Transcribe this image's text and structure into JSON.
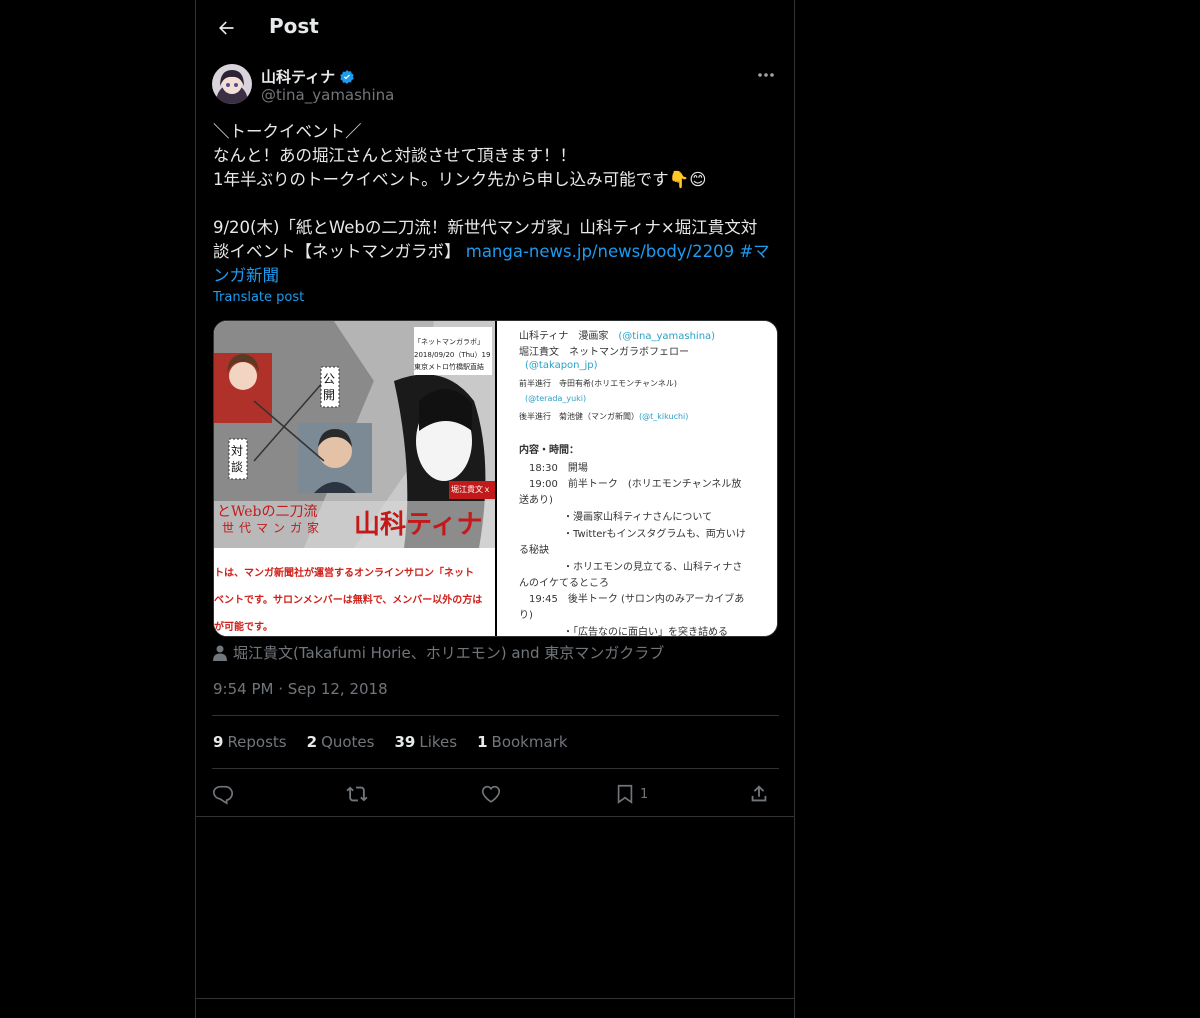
{
  "header": {
    "title": "Post",
    "back_icon": "arrow-left-icon"
  },
  "author": {
    "display_name": "山科ティナ",
    "handle": "@tina_yamashina",
    "verified": true
  },
  "tweet": {
    "lines": [
      "＼トークイベント／",
      "なんと！あの堀江さんと対談させて頂きます！！",
      "1年半ぶりのトークイベント。リンク先から申し込み可能です👇😊",
      "",
      "9/20(木)「紙とWebの二刀流！新世代マンガ家」山科ティナ×堀江貴文対",
      "談イベント【ネットマンガラボ】 "
    ],
    "link_text": "manga-news.jp/news/body/2209",
    "hashtag": "#マンガ新聞",
    "translate_label": "Translate post"
  },
  "media": {
    "left": {
      "header_1": "「ネットマンガラボ」",
      "header_2": "2018/09/20（Thu）19",
      "header_3": "東京メトロ竹橋駅直結",
      "vertical_1": "公開",
      "vertical_2": "対談",
      "subtitle_1": "とWebの二刀流",
      "subtitle_2": "世代マンガ家",
      "big_name": "山科ティナ",
      "tag": "堀江貴文ｘ",
      "red_1": "トは、マンガ新聞社が運営するオンラインサロン「ネット",
      "red_2": "ベントです。サロンメンバーは無料で、メンバー以外の方は",
      "red_3": "が可能です。"
    },
    "right": {
      "l1a": "山科ティナ　漫画家　",
      "l1b": "(@tina_yamashina)",
      "l2": "堀江貴文　ネットマンガラボフェロー",
      "l3": "(@takapon_jp)",
      "l4": "前半進行　寺田有希(ホリエモンチャンネル)",
      "l5": "(@terada_yuki)",
      "l6a": "後半進行　菊池健（マンガ新聞）",
      "l6b": "(@t_kikuchi)",
      "l7": "内容・時間：",
      "l8": "18:30　開場",
      "l9": "19:00　前半トーク　(ホリエモンチャンネル放",
      "l10": "送あり)",
      "l11": "・漫画家山科ティナさんについて",
      "l12": "・Twitterもインスタグラムも、両方いけ",
      "l13": "る秘訣",
      "l14": "・ホリエモンの見立てる、山科ティナさ",
      "l15": "んのイケてるところ",
      "l16": "19:45　後半トーク (サロン内のみアーカイブあ",
      "l17": "り)",
      "l18": "・「広告なのに面白い」を突き詰める"
    }
  },
  "tagged": "堀江貴文(Takafumi Horie、ホリエモン) and 東京マンガクラブ",
  "timestamp": {
    "time": "9:54 PM",
    "sep": "·",
    "date": "Sep 12, 2018"
  },
  "stats": {
    "reposts_count": "9",
    "reposts_label": "Reposts",
    "quotes_count": "2",
    "quotes_label": "Quotes",
    "likes_count": "39",
    "likes_label": "Likes",
    "bookmarks_count": "1",
    "bookmarks_label": "Bookmark"
  },
  "actions": {
    "bookmark_count": "1"
  },
  "colors": {
    "background": "#000000",
    "accent": "#1d9bf0",
    "muted": "#71767b",
    "border": "#2f3336"
  }
}
